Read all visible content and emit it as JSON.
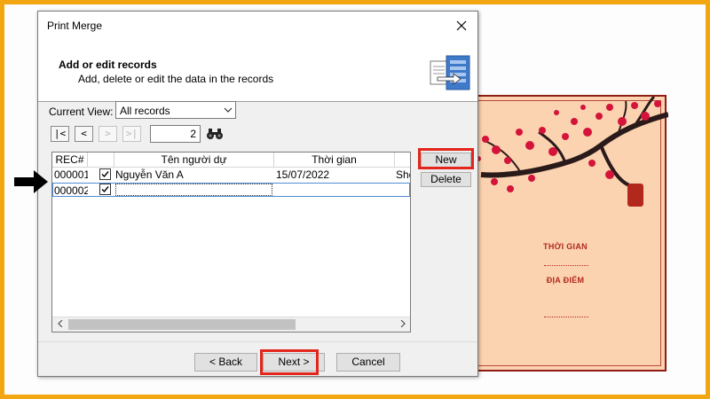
{
  "dialog": {
    "title": "Print Merge",
    "header_title": "Add or edit records",
    "header_subtitle": "Add, delete or edit the data in the records",
    "current_view_label": "Current View:",
    "current_view_value": "All records",
    "nav": {
      "first": "|<",
      "prev": "<",
      "next": ">",
      "last": ">|"
    },
    "record_number": "2",
    "columns": [
      "REC#",
      "",
      "Tên người dự",
      "Thời gian",
      "She"
    ],
    "rows": [
      {
        "rec": "000001",
        "checked": true,
        "name": "Nguyễn Văn A",
        "time": "15/07/2022",
        "extra": "She"
      },
      {
        "rec": "000002",
        "checked": true,
        "name": "",
        "time": "",
        "extra": ""
      }
    ],
    "side_buttons": {
      "new": "New",
      "delete": "Delete"
    },
    "footer_buttons": {
      "back": "< Back",
      "next": "Next >",
      "cancel": "Cancel"
    }
  },
  "card": {
    "label_time": "THỜI GIAN",
    "label_place": "ĐỊA ĐIỂM"
  },
  "colors": {
    "highlight": "#e3261b",
    "frame": "#f2a712",
    "card_bg": "#fbd3b0",
    "card_text": "#b3281d"
  }
}
